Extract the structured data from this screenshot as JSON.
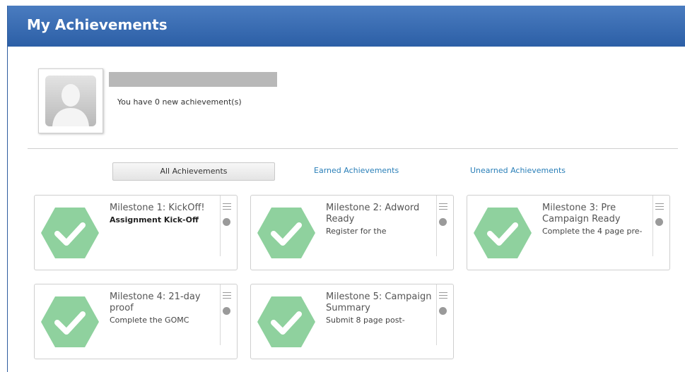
{
  "header": {
    "title": "My Achievements"
  },
  "profile": {
    "new_achievements_text": "You have 0 new achievement(s)"
  },
  "tabs": [
    {
      "label": "All Achievements",
      "active": true
    },
    {
      "label": "Earned Achievements",
      "active": false
    },
    {
      "label": "Unearned Achievements",
      "active": false
    }
  ],
  "achievements": [
    {
      "title": "Milestone 1: KickOff!",
      "desc": "Assignment Kick-Off",
      "desc_bold": true
    },
    {
      "title": "Milestone 2: Adword Ready",
      "desc": "Register for the",
      "desc_bold": false
    },
    {
      "title": "Milestone 3: Pre Campaign Ready",
      "desc": "Complete the 4 page pre-",
      "desc_bold": false
    },
    {
      "title": "Milestone 4: 21-day proof",
      "desc": "Complete the GOMC",
      "desc_bold": false
    },
    {
      "title": "Milestone 5: Campaign Summary",
      "desc": "Submit 8 page post-",
      "desc_bold": false
    }
  ],
  "colors": {
    "header": "#3a6db5",
    "badge": "#8fd19e",
    "link": "#2a7fb8"
  },
  "icons": {
    "badge": "checkmark-hexagon-icon",
    "menu": "list-icon",
    "status": "status-dot-icon",
    "avatar": "user-silhouette-icon"
  }
}
